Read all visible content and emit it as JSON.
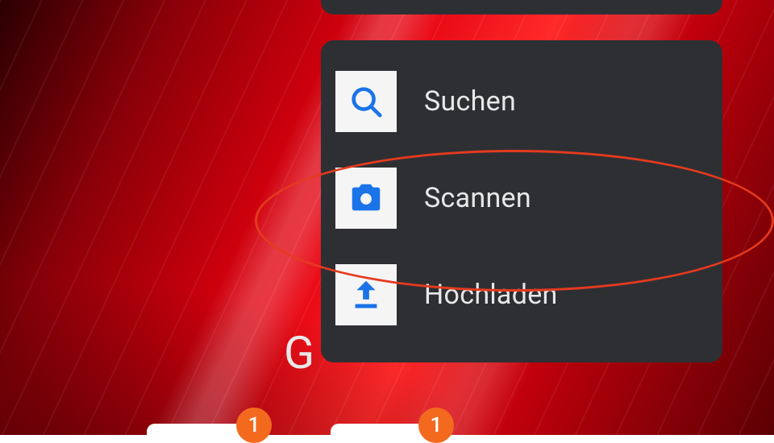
{
  "menu": {
    "items": [
      {
        "label": "Suchen",
        "icon": "search-icon"
      },
      {
        "label": "Scannen",
        "icon": "camera-icon"
      },
      {
        "label": "Hochladen",
        "icon": "upload-icon"
      }
    ]
  },
  "badges": {
    "b1": "1",
    "b2": "1"
  },
  "partial_letter": "G",
  "colors": {
    "accent": "#1a73e8",
    "menu_bg": "#2e2f33",
    "badge": "#f36a1f",
    "ring": "#e53a1e"
  },
  "annotation": {
    "highlighted_item_index": 1
  }
}
